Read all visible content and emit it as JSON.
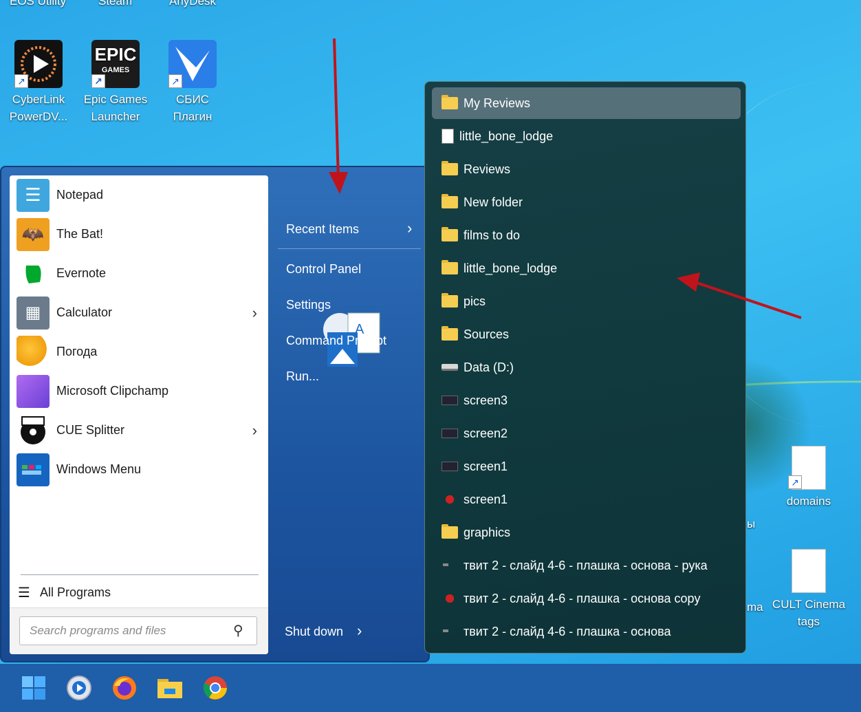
{
  "desktop": {
    "top_labels": [
      "EOS Utility",
      "Steam",
      "AnyDesk"
    ],
    "icons": [
      {
        "label": "CyberLink PowerDV...",
        "icon": "cyberlink-icon"
      },
      {
        "label": "Epic Games Launcher",
        "icon": "epic-games-icon"
      },
      {
        "label": "СБИС Плагин",
        "icon": "sbis-icon"
      }
    ],
    "right_icons": [
      {
        "label": "domains",
        "icon": "document-icon"
      },
      {
        "label": "CULT Cinema tags",
        "icon": "document-icon"
      }
    ],
    "partial_labels": [
      "ы",
      "ma"
    ]
  },
  "start_menu": {
    "programs": [
      {
        "label": "Notepad",
        "icon": "notepad-icon",
        "submenu": false
      },
      {
        "label": "The Bat!",
        "icon": "the-bat-icon",
        "submenu": false
      },
      {
        "label": "Evernote",
        "icon": "evernote-icon",
        "submenu": false
      },
      {
        "label": "Calculator",
        "icon": "calculator-icon",
        "submenu": true
      },
      {
        "label": "Погода",
        "icon": "weather-icon",
        "submenu": false
      },
      {
        "label": "Microsoft Clipchamp",
        "icon": "clipchamp-icon",
        "submenu": false
      },
      {
        "label": "CUE Splitter",
        "icon": "cue-splitter-icon",
        "submenu": true
      },
      {
        "label": "Windows Menu",
        "icon": "windows-menu-icon",
        "submenu": false
      }
    ],
    "all_programs": "All Programs",
    "search_placeholder": "Search programs and files",
    "right": {
      "recent_items": "Recent Items",
      "control_panel": "Control Panel",
      "settings": "Settings",
      "command_prompt": "Command Prompt",
      "run": "Run...",
      "shut_down": "Shut down"
    }
  },
  "recent": {
    "items": [
      {
        "label": "My Reviews",
        "type": "folder",
        "selected": true
      },
      {
        "label": "little_bone_lodge",
        "type": "doc"
      },
      {
        "label": "Reviews",
        "type": "folder"
      },
      {
        "label": "New folder",
        "type": "folder"
      },
      {
        "label": "films to do",
        "type": "folder"
      },
      {
        "label": "little_bone_lodge",
        "type": "folder"
      },
      {
        "label": "pics",
        "type": "folder"
      },
      {
        "label": "Sources",
        "type": "folder"
      },
      {
        "label": "Data (D:)",
        "type": "drive"
      },
      {
        "label": "screen3",
        "type": "shot"
      },
      {
        "label": "screen2",
        "type": "shot"
      },
      {
        "label": "screen1",
        "type": "shot"
      },
      {
        "label": "screen1",
        "type": "bat"
      },
      {
        "label": "graphics",
        "type": "folder"
      },
      {
        "label": "твит 2 - слайд 4-6 - плашка - основа - рука",
        "type": "tiny"
      },
      {
        "label": "твит 2 - слайд 4-6 - плашка - основа copy",
        "type": "bat"
      },
      {
        "label": "твит 2 - слайд 4-6 - плашка - основа",
        "type": "tiny"
      }
    ]
  },
  "taskbar": {
    "apps": [
      "start-button-icon",
      "media-player-icon",
      "firefox-icon",
      "file-explorer-icon",
      "chrome-icon"
    ]
  },
  "colors": {
    "start_bg": "#1d55a0",
    "recent_bg": "#103a3e",
    "taskbar": "#1f5ea8",
    "arrow": "#c0141b"
  }
}
